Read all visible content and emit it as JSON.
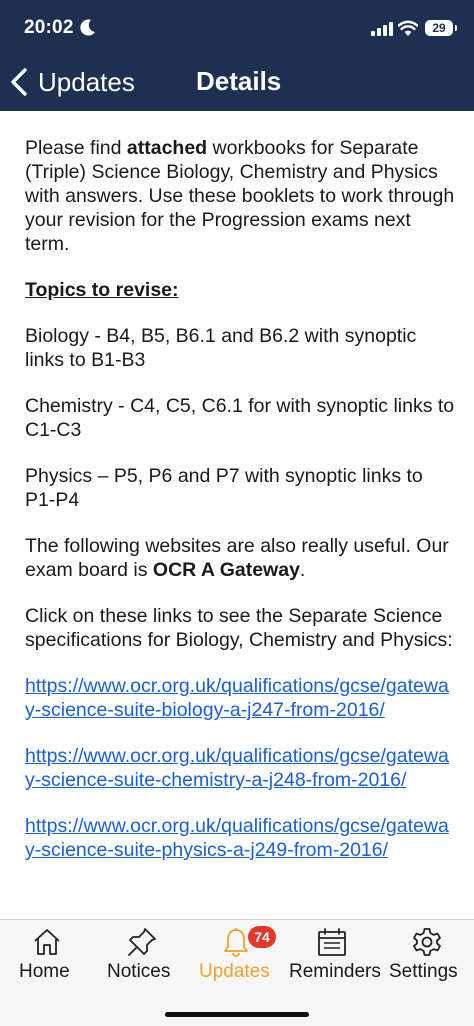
{
  "status": {
    "time": "20:02",
    "battery": "29"
  },
  "nav": {
    "back_label": "Updates",
    "title": "Details"
  },
  "article": {
    "intro_before_bold": "Please find ",
    "intro_bold": "attached",
    "intro_after_bold": " workbooks for Separate (Triple) Science Biology, Chemistry and Physics with answers. Use these booklets to work through your revision for the Progression exams next term.",
    "topics_heading": "Topics to revise:",
    "biology": "Biology - B4, B5, B6.1 and B6.2 with synoptic links to B1-B3",
    "chemistry": "Chemistry - C4, C5, C6.1 for with synoptic links to C1-C3",
    "physics": "Physics – P5, P6 and P7 with synoptic links to P1-P4",
    "websites_text": "The following websites are also really useful.  Our exam board is ",
    "exam_board": "OCR A Gateway",
    "websites_end": ".",
    "links_intro": "Click on these links to see the Separate Science specifications for Biology, Chemistry and Physics:",
    "links": [
      "https://www.ocr.org.uk/qualifications/gcse/gateway-science-suite-biology-a-j247-from-2016/",
      "https://www.ocr.org.uk/qualifications/gcse/gateway-science-suite-chemistry-a-j248-from-2016/",
      "https://www.ocr.org.uk/qualifications/gcse/gateway-science-suite-physics-a-j249-from-2016/"
    ]
  },
  "tabs": [
    {
      "label": "Home",
      "icon": "home-icon"
    },
    {
      "label": "Notices",
      "icon": "pin-icon"
    },
    {
      "label": "Updates",
      "icon": "bell-icon",
      "badge": "74",
      "active": true
    },
    {
      "label": "Reminders",
      "icon": "calendar-icon"
    },
    {
      "label": "Settings",
      "icon": "gear-icon"
    }
  ],
  "colors": {
    "header_bg": "#1e3052",
    "link": "#1a5fd6",
    "active_tab": "#f1a12c",
    "badge": "#e6352b"
  }
}
